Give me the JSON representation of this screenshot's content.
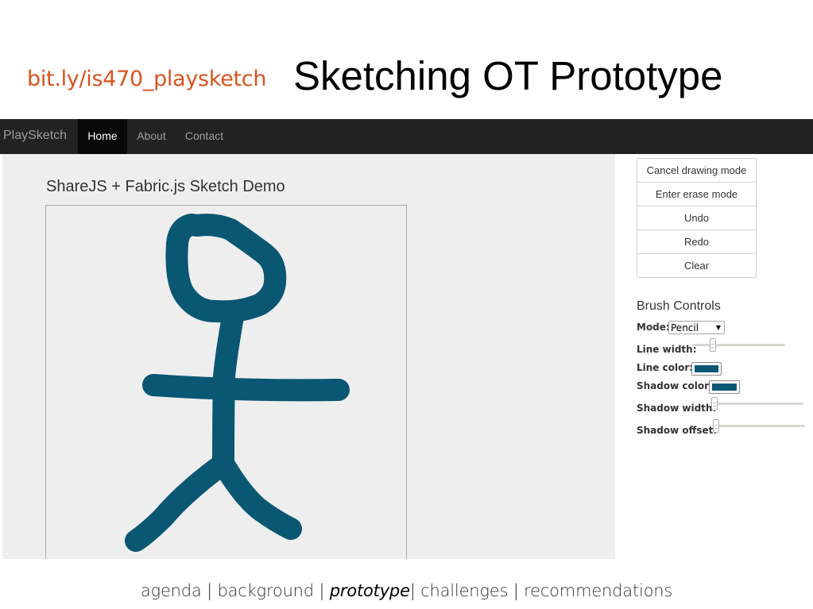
{
  "slide": {
    "link": "bit.ly/is470_playsketch",
    "title": "Sketching OT Prototype"
  },
  "navbar": {
    "brand": "PlaySketch",
    "items": [
      {
        "label": "Home",
        "active": true
      },
      {
        "label": "About",
        "active": false
      },
      {
        "label": "Contact",
        "active": false
      }
    ]
  },
  "demo": {
    "title": "ShareJS + Fabric.js Sketch Demo",
    "sketch_color": "#0a5774"
  },
  "actions": [
    "Cancel drawing mode",
    "Enter erase mode",
    "Undo",
    "Redo",
    "Clear"
  ],
  "brush": {
    "title": "Brush Controls",
    "mode_label": "Mode:",
    "mode_value": "Pencil",
    "line_width_label": "Line width:",
    "line_color_label": "Line color:",
    "line_color": "#0a5774",
    "shadow_color_label": "Shadow color:",
    "shadow_color": "#0a5774",
    "shadow_width_label": "Shadow width:",
    "shadow_offset_label": "Shadow offset:"
  },
  "footer": {
    "items": [
      "agenda",
      "background",
      "prototype",
      "challenges",
      "recommendations"
    ],
    "current": "prototype",
    "separator": "|"
  }
}
